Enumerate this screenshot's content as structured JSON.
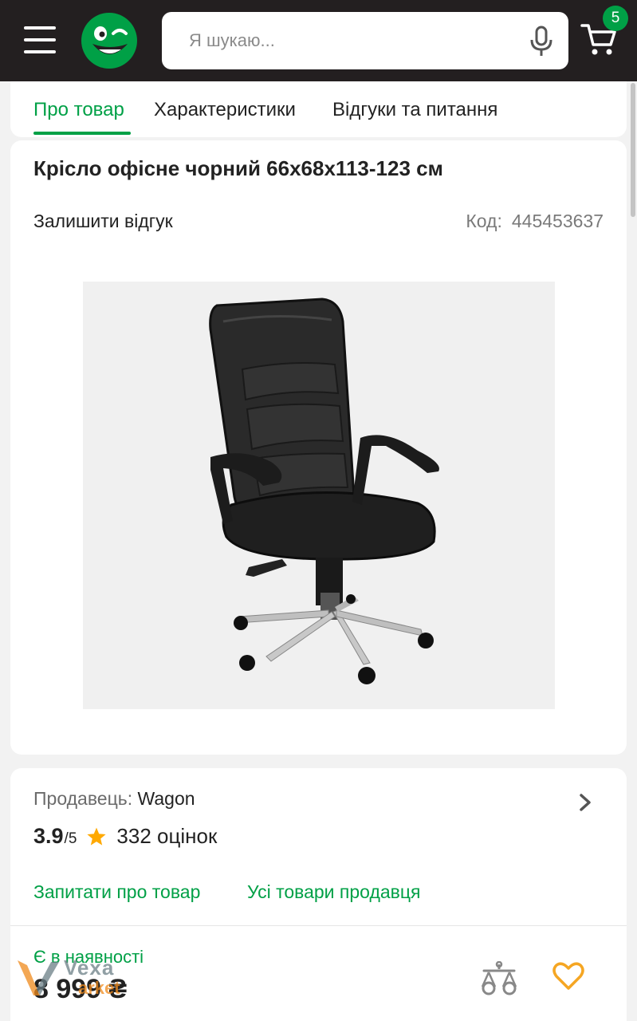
{
  "header": {
    "search_placeholder": "Я шукаю...",
    "cart_count": "5",
    "accent_color": "#00a046",
    "icons": [
      "menu-icon",
      "logo-smile-icon",
      "microphone-icon",
      "cart-icon"
    ]
  },
  "tabs": [
    {
      "label": "Про товар",
      "active": true
    },
    {
      "label": "Характеристики",
      "active": false
    },
    {
      "label": "Відгуки та питання",
      "active": false
    }
  ],
  "product": {
    "title": "Крісло офісне чорний 66x68x113-123 см",
    "review_link": "Залишити відгук",
    "code_label": "Код:",
    "code_value": "445453637",
    "image": "black-office-chair-photo"
  },
  "seller": {
    "label": "Продавець:",
    "name": "Wagon",
    "rating": "3.9",
    "rating_max": "/5",
    "reviews_count": "332 оцінок",
    "ask_link": "Запитати про товар",
    "all_products_link": "Усі товари продавця"
  },
  "offer": {
    "availability": "Є в наявності",
    "price": "8 999 ₴",
    "icons": [
      "compare-scales-icon",
      "heart-icon"
    ]
  },
  "watermark": {
    "line1": "Vexa",
    "line2": "arket"
  }
}
